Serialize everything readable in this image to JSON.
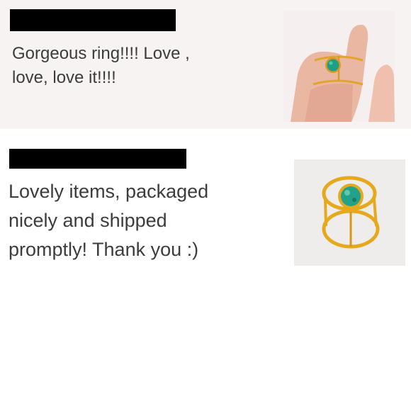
{
  "reviews": [
    {
      "text": "Gorgeous ring!!!! Love ,\nlove, love it!!!!",
      "photo_icon": "ring-on-finger-photo"
    },
    {
      "text": "Lovely items, packaged\nnicely and shipped\npromptly! Thank you :)",
      "photo_icon": "ring-product-photo"
    }
  ],
  "colors": {
    "text": "#3c3c3c",
    "review_1_background": "#f7f3f3",
    "redaction": "#000000",
    "gold": "#e0a52a",
    "turquoise": "#1f9e86"
  }
}
